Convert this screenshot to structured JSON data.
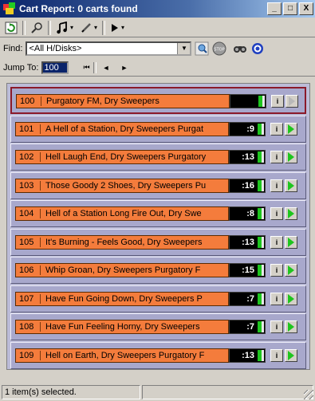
{
  "window": {
    "title": "Cart Report: 0 carts found",
    "minimize": "_",
    "maximize": "□",
    "close": "X"
  },
  "toolbar": {
    "refresh_icon": "refresh-icon",
    "search_icon": "search-icon",
    "music_icon": "music-note-icon",
    "pen_icon": "pen-icon",
    "play_icon": "play-icon"
  },
  "find": {
    "label": "Find:",
    "value": "<All H/Disks>"
  },
  "jump": {
    "label": "Jump To:",
    "value": "100",
    "first": "⏮",
    "prev": "◄",
    "next": "►"
  },
  "carts": [
    {
      "number": "100",
      "title": "Purgatory FM, Dry Sweepers",
      "time": "",
      "selected": true,
      "playable": false
    },
    {
      "number": "101",
      "title": "A Hell of a Station, Dry Sweepers Purgat",
      "time": ":9",
      "selected": false,
      "playable": true
    },
    {
      "number": "102",
      "title": "Hell Laugh End, Dry Sweepers Purgatory",
      "time": ":13",
      "selected": false,
      "playable": true
    },
    {
      "number": "103",
      "title": "Those Goody 2 Shoes, Dry Sweepers Pu",
      "time": ":16",
      "selected": false,
      "playable": true
    },
    {
      "number": "104",
      "title": "Hell of a Station Long  Fire Out, Dry Swe",
      "time": ":8",
      "selected": false,
      "playable": true
    },
    {
      "number": "105",
      "title": "It's Burning - Feels Good, Dry Sweepers",
      "time": ":13",
      "selected": false,
      "playable": true
    },
    {
      "number": "106",
      "title": "Whip Groan, Dry Sweepers Purgatory F",
      "time": ":15",
      "selected": false,
      "playable": true
    },
    {
      "number": "107",
      "title": "Have Fun Going Down, Dry Sweepers P",
      "time": ":7",
      "selected": false,
      "playable": true
    },
    {
      "number": "108",
      "title": "Have Fun Feeling Horny, Dry Sweepers",
      "time": ":7",
      "selected": false,
      "playable": true
    },
    {
      "number": "109",
      "title": "Hell on Earth, Dry Sweepers Purgatory F",
      "time": ":13",
      "selected": false,
      "playable": true
    }
  ],
  "status": {
    "text": "1 item(s) selected."
  }
}
